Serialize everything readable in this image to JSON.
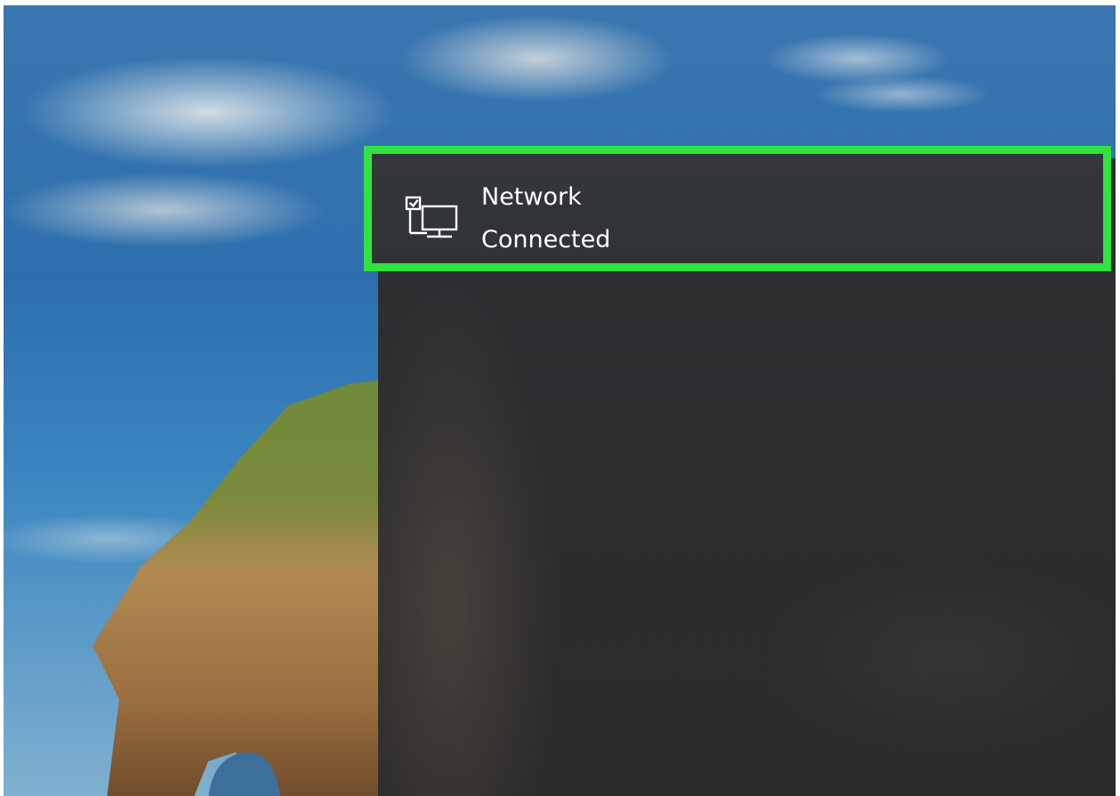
{
  "network_tile": {
    "title": "Network",
    "status": "Connected",
    "icon": "wired-network-pc-icon",
    "highlight_color": "#31e33e"
  },
  "desktop": {
    "wallpaper": "sky-and-rock-wallpaper"
  }
}
